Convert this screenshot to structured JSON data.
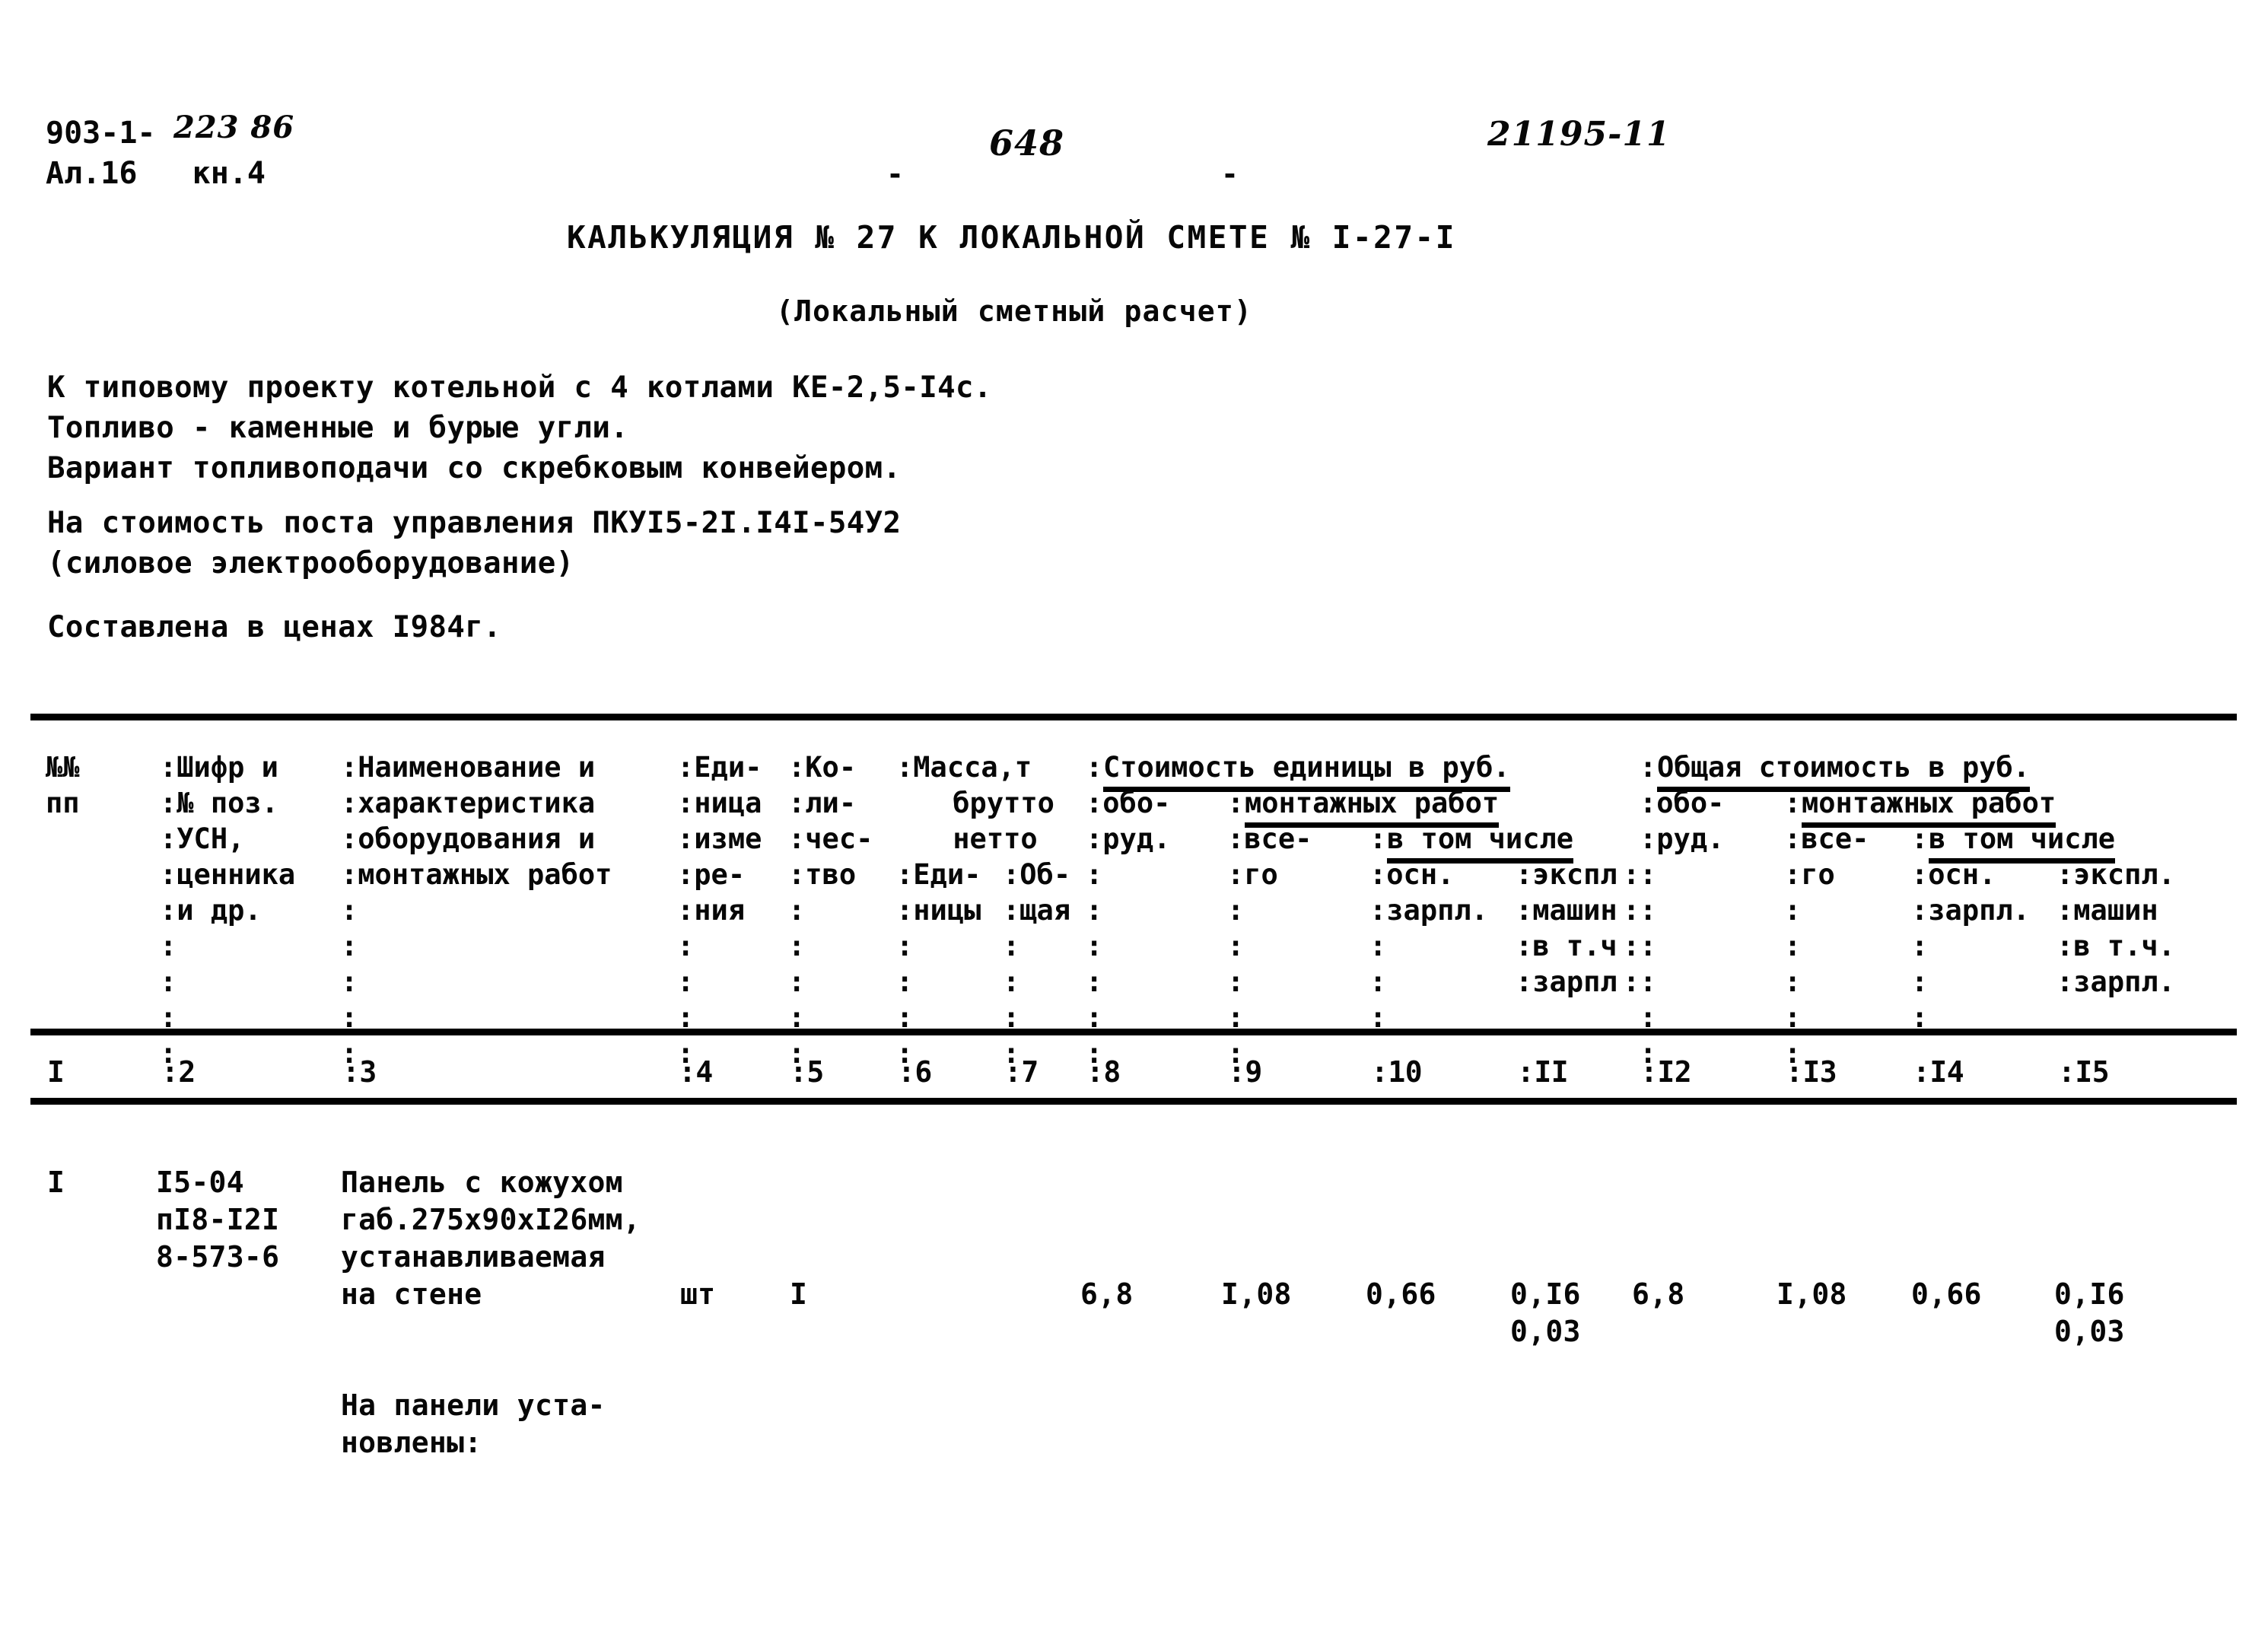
{
  "header": {
    "series_code": "903-1-",
    "series_code_hand": "223 86",
    "album_line": "Ал.16   кн.4",
    "page_dash_left": "-",
    "page_number_hand": "648",
    "page_dash_right": "-",
    "archive_code_hand": "21195-11"
  },
  "title": {
    "main": "КАЛЬКУЛЯЦИЯ № 27 К ЛОКАЛЬНОЙ СМЕТЕ № I-27-I",
    "subtitle": "(Локальный сметный расчет)"
  },
  "intro": {
    "line1": "К типовому проекту котельной с 4 котлами КЕ-2,5-I4с.",
    "line2": "Топливо - каменные и бурые угли.",
    "line3": "Вариант топливоподачи со скребковым конвейером.",
    "line4": "На стоимость поста управления ПКУI5-2I.I4I-54У2",
    "line5": "(силовое электрооборудование)",
    "line6": "Составлена в ценах I984г."
  },
  "table": {
    "header": {
      "col1": [
        "№№",
        "пп"
      ],
      "col2": [
        ":Шифр и",
        ":№ поз.",
        ":УСН,",
        ":ценника",
        ":и др.",
        ":",
        ":",
        ":",
        ":"
      ],
      "col3": [
        ":Наименование и",
        ":характеристика",
        ":оборудования и",
        ":монтажных работ",
        ":",
        ":",
        ":",
        ":",
        ":"
      ],
      "col4": [
        ":Еди-",
        ":ница",
        ":изме",
        ":ре-",
        ":ния",
        ":",
        ":",
        ":",
        ":"
      ],
      "col5": [
        ":Ко-",
        ":ли-",
        ":чес-",
        ":тво",
        ":",
        ":",
        ":",
        ":",
        ":"
      ],
      "col6_group": ":Масса,т",
      "col6": [
        " брутто",
        " нетто"
      ],
      "col6b": [
        ":Еди-",
        ":ницы",
        ":",
        ":",
        ":",
        ":"
      ],
      "col7b": [
        ":Об-",
        ":щая",
        ":",
        ":",
        ":",
        ":"
      ],
      "group_unit_cost": "Стоимость единицы в руб.",
      "group_total_cost": "Общая стоимость в руб.",
      "sub_mount_works": "монтажных работ",
      "sub_including": "в том числе",
      "col8": [
        ":обо-",
        ":руд."
      ],
      "col9": [
        ":все-",
        ":го"
      ],
      "col10": [
        ":осн.",
        ":зарпл."
      ],
      "col11": [
        ":экспл",
        ":машин",
        ":в т.ч",
        ":зарпл"
      ],
      "col12": [
        ":обо-",
        ":руд."
      ],
      "col13": [
        ":все-",
        ":го"
      ],
      "col14": [
        ":осн.",
        ":зарпл."
      ],
      "col15": [
        ":экспл.",
        ":машин",
        ":в т.ч.",
        ":зарпл."
      ]
    },
    "column_numbers": [
      "I",
      ":2",
      ":3",
      ":4",
      ":5",
      ":6",
      ":7",
      ":8",
      ":9",
      ":10",
      ":II",
      ":I2",
      ":I3",
      ":I4",
      ":I5"
    ],
    "rows": [
      {
        "num": "I",
        "codes": [
          "I5-04",
          "пI8-I2I",
          "8-573-6"
        ],
        "description": [
          "Панель с кожухом",
          "габ.275х90хI26мм,",
          "устанавливаемая",
          "на стене"
        ],
        "unit": "шт",
        "quantity": "I",
        "mass_unit": "",
        "mass_total": "",
        "unit_equipment": "6,8",
        "unit_mount_total": "I,08",
        "unit_mount_salary": "0,66",
        "unit_mount_machines": "0,I6",
        "unit_mount_machines_salary": "0,03",
        "total_equipment": "6,8",
        "total_mount_total": "I,08",
        "total_mount_salary": "0,66",
        "total_mount_machines": "0,I6",
        "total_mount_machines_salary": "0,03"
      }
    ],
    "footer_note": [
      "На панели уста-",
      "новлены:"
    ]
  }
}
